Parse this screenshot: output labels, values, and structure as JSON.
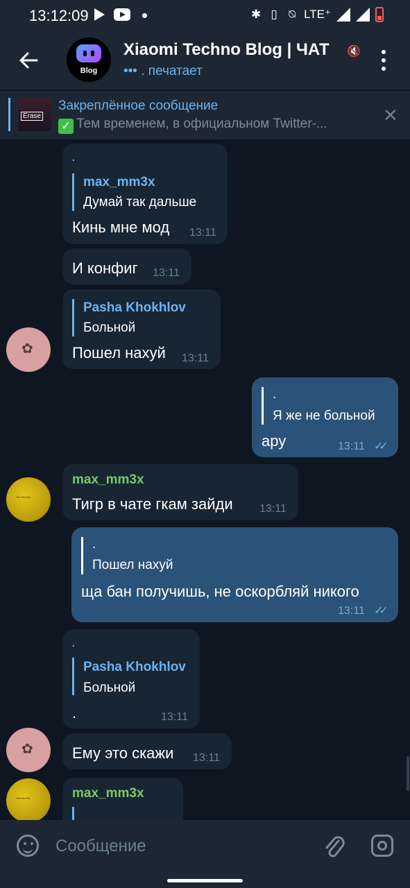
{
  "statusbar": {
    "time": "13:12:09",
    "network": "LTE⁺"
  },
  "header": {
    "title": "Xiaomi Techno Blog | ЧАТ",
    "avatar_label": "Blog",
    "status_dots": "•••",
    "status": ". печатает"
  },
  "pinned": {
    "title": "Закреплённое сообщение",
    "check": "✓",
    "text": "Тем временем, в официальном Twitter-...",
    "thumb_label": "Erase"
  },
  "messages": [
    {
      "dir": "in",
      "top_dot": ".",
      "reply_name": "max_mm3x",
      "reply_text": "Думай так дальше",
      "text": "Кинь мне мод",
      "time": "13:11"
    },
    {
      "dir": "in",
      "text": "И конфиг",
      "time": "13:11"
    },
    {
      "dir": "in",
      "reply_name": "Pasha Khokhlov",
      "reply_text": "Больной",
      "text": "Пошел нахуй",
      "time": "13:11"
    },
    {
      "dir": "out",
      "reply_name": ".",
      "reply_text": "Я же не больной",
      "text": "ару",
      "time": "13:11"
    },
    {
      "dir": "in",
      "sender": "max_mm3x",
      "text": "Тигр в чате гкам зайди",
      "time": "13:11"
    },
    {
      "dir": "out",
      "reply_name": ".",
      "reply_text": "Пошел нахуй",
      "text": "ща бан получишь, не оскорбляй никого",
      "time": "13:11"
    },
    {
      "dir": "in",
      "top_dot": ".",
      "reply_name": "Pasha Khokhlov",
      "reply_text": "Больной",
      "text": ".",
      "time": "13:11"
    },
    {
      "dir": "in",
      "text": "Ему это скажи",
      "time": "13:11"
    },
    {
      "dir": "in",
      "sender": "max_mm3x",
      "text": ""
    }
  ],
  "composer": {
    "placeholder": "Сообщение"
  },
  "colors": {
    "accent": "#6ab3f3",
    "background": "#0e1621",
    "incoming": "#182533",
    "outgoing": "#2b5278",
    "sender_green": "#7bc862"
  }
}
